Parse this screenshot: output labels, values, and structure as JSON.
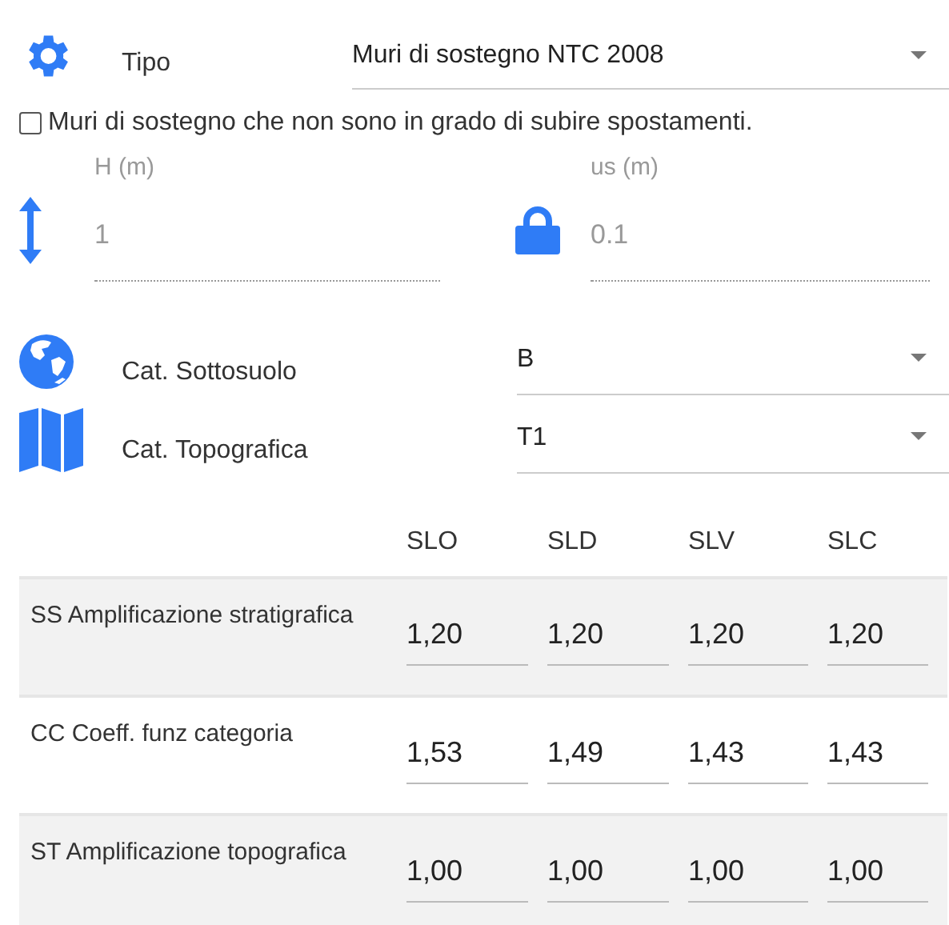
{
  "tipo": {
    "label": "Tipo",
    "value": "Muri di sostegno NTC 2008"
  },
  "checkbox": {
    "label": "Muri di sostegno che non sono in grado di subire spostamenti.",
    "checked": false
  },
  "fields": [
    {
      "label": "H (m)",
      "value": "1",
      "disabled": true
    },
    {
      "label": "us (m)",
      "value": "0.1",
      "disabled": true
    }
  ],
  "categories": [
    {
      "label": "Cat. Sottosuolo",
      "value": "B"
    },
    {
      "label": "Cat. Topografica",
      "value": "T1"
    }
  ],
  "table": {
    "columns": [
      "SLO",
      "SLD",
      "SLV",
      "SLC"
    ],
    "rows": [
      {
        "label": "SS Amplificazione stratigrafica",
        "values": [
          "1,20",
          "1,20",
          "1,20",
          "1,20"
        ]
      },
      {
        "label": "CC Coeff. funz categoria",
        "values": [
          "1,53",
          "1,49",
          "1,43",
          "1,43"
        ]
      },
      {
        "label": "ST Amplificazione topografica",
        "values": [
          "1,00",
          "1,00",
          "1,00",
          "1,00"
        ]
      }
    ]
  }
}
